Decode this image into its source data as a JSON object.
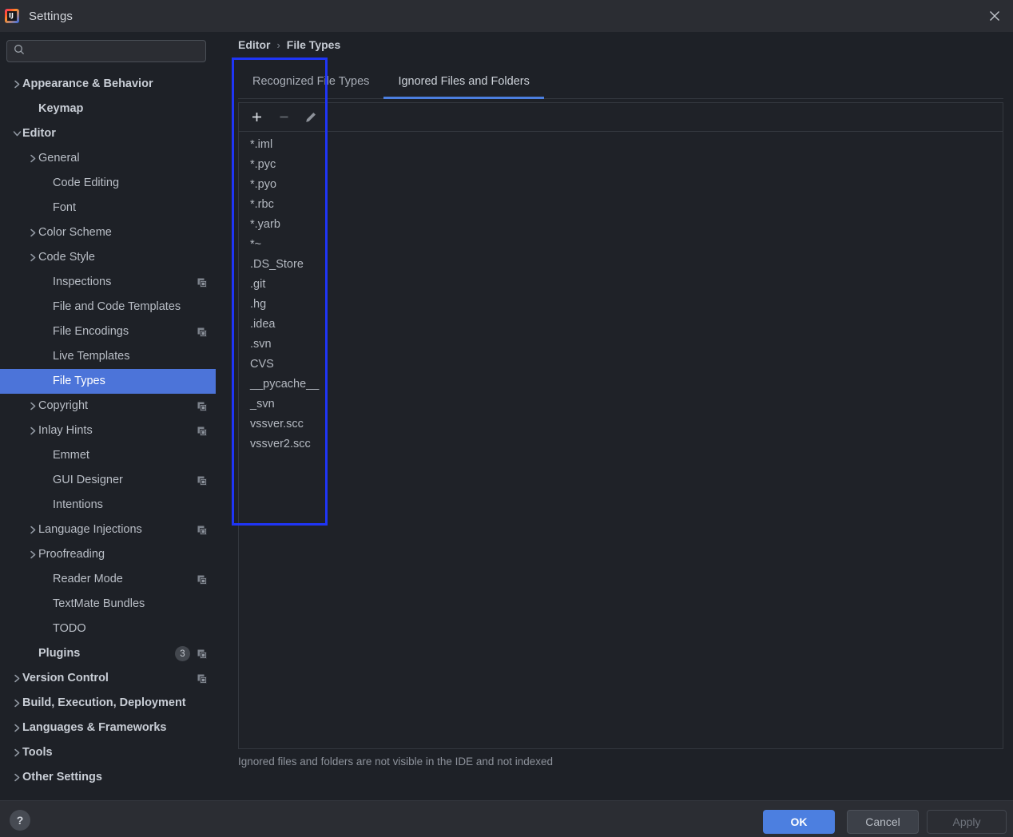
{
  "window": {
    "title": "Settings",
    "logo_icon": "intellij-idea-logo",
    "close_icon": "close-icon"
  },
  "search": {
    "placeholder": "",
    "value": "",
    "icon": "search-icon"
  },
  "sidebar": {
    "items": [
      {
        "label": "Appearance & Behavior",
        "indent": 0,
        "arrow": "chevron-right",
        "bold": true,
        "badge": null,
        "copy": false,
        "selected": false
      },
      {
        "label": "Keymap",
        "indent": 1,
        "arrow": "none",
        "bold": true,
        "badge": null,
        "copy": false,
        "selected": false
      },
      {
        "label": "Editor",
        "indent": 0,
        "arrow": "chevron-down",
        "bold": true,
        "badge": null,
        "copy": false,
        "selected": false
      },
      {
        "label": "General",
        "indent": 1,
        "arrow": "chevron-right",
        "bold": false,
        "badge": null,
        "copy": false,
        "selected": false
      },
      {
        "label": "Code Editing",
        "indent": 2,
        "arrow": "none",
        "bold": false,
        "badge": null,
        "copy": false,
        "selected": false
      },
      {
        "label": "Font",
        "indent": 2,
        "arrow": "none",
        "bold": false,
        "badge": null,
        "copy": false,
        "selected": false
      },
      {
        "label": "Color Scheme",
        "indent": 1,
        "arrow": "chevron-right",
        "bold": false,
        "badge": null,
        "copy": false,
        "selected": false
      },
      {
        "label": "Code Style",
        "indent": 1,
        "arrow": "chevron-right",
        "bold": false,
        "badge": null,
        "copy": false,
        "selected": false
      },
      {
        "label": "Inspections",
        "indent": 2,
        "arrow": "none",
        "bold": false,
        "badge": null,
        "copy": true,
        "selected": false
      },
      {
        "label": "File and Code Templates",
        "indent": 2,
        "arrow": "none",
        "bold": false,
        "badge": null,
        "copy": false,
        "selected": false
      },
      {
        "label": "File Encodings",
        "indent": 2,
        "arrow": "none",
        "bold": false,
        "badge": null,
        "copy": true,
        "selected": false
      },
      {
        "label": "Live Templates",
        "indent": 2,
        "arrow": "none",
        "bold": false,
        "badge": null,
        "copy": false,
        "selected": false
      },
      {
        "label": "File Types",
        "indent": 2,
        "arrow": "none",
        "bold": false,
        "badge": null,
        "copy": false,
        "selected": true
      },
      {
        "label": "Copyright",
        "indent": 1,
        "arrow": "chevron-right",
        "bold": false,
        "badge": null,
        "copy": true,
        "selected": false
      },
      {
        "label": "Inlay Hints",
        "indent": 1,
        "arrow": "chevron-right",
        "bold": false,
        "badge": null,
        "copy": true,
        "selected": false
      },
      {
        "label": "Emmet",
        "indent": 2,
        "arrow": "none",
        "bold": false,
        "badge": null,
        "copy": false,
        "selected": false
      },
      {
        "label": "GUI Designer",
        "indent": 2,
        "arrow": "none",
        "bold": false,
        "badge": null,
        "copy": true,
        "selected": false
      },
      {
        "label": "Intentions",
        "indent": 2,
        "arrow": "none",
        "bold": false,
        "badge": null,
        "copy": false,
        "selected": false
      },
      {
        "label": "Language Injections",
        "indent": 1,
        "arrow": "chevron-right",
        "bold": false,
        "badge": null,
        "copy": true,
        "selected": false
      },
      {
        "label": "Proofreading",
        "indent": 1,
        "arrow": "chevron-right",
        "bold": false,
        "badge": null,
        "copy": false,
        "selected": false
      },
      {
        "label": "Reader Mode",
        "indent": 2,
        "arrow": "none",
        "bold": false,
        "badge": null,
        "copy": true,
        "selected": false
      },
      {
        "label": "TextMate Bundles",
        "indent": 2,
        "arrow": "none",
        "bold": false,
        "badge": null,
        "copy": false,
        "selected": false
      },
      {
        "label": "TODO",
        "indent": 2,
        "arrow": "none",
        "bold": false,
        "badge": null,
        "copy": false,
        "selected": false
      },
      {
        "label": "Plugins",
        "indent": 1,
        "arrow": "none",
        "bold": true,
        "badge": "3",
        "copy": true,
        "selected": false
      },
      {
        "label": "Version Control",
        "indent": 0,
        "arrow": "chevron-right",
        "bold": true,
        "badge": null,
        "copy": true,
        "selected": false
      },
      {
        "label": "Build, Execution, Deployment",
        "indent": 0,
        "arrow": "chevron-right",
        "bold": true,
        "badge": null,
        "copy": false,
        "selected": false
      },
      {
        "label": "Languages & Frameworks",
        "indent": 0,
        "arrow": "chevron-right",
        "bold": true,
        "badge": null,
        "copy": false,
        "selected": false
      },
      {
        "label": "Tools",
        "indent": 0,
        "arrow": "chevron-right",
        "bold": true,
        "badge": null,
        "copy": false,
        "selected": false
      },
      {
        "label": "Other Settings",
        "indent": 0,
        "arrow": "chevron-right",
        "bold": true,
        "badge": null,
        "copy": false,
        "selected": false
      }
    ]
  },
  "main": {
    "breadcrumb": {
      "parent": "Editor",
      "separator": "›",
      "current": "File Types"
    },
    "tabs": [
      {
        "label": "Recognized File Types",
        "active": false
      },
      {
        "label": "Ignored Files and Folders",
        "active": true
      }
    ],
    "toolbar": [
      {
        "name": "add-button",
        "icon": "plus-icon",
        "enabled": true
      },
      {
        "name": "remove-button",
        "icon": "minus-icon",
        "enabled": false
      },
      {
        "name": "edit-button",
        "icon": "pencil-icon",
        "enabled": true
      }
    ],
    "ignored_items": [
      "*.iml",
      "*.pyc",
      "*.pyo",
      "*.rbc",
      "*.yarb",
      "*~",
      ".DS_Store",
      ".git",
      ".hg",
      ".idea",
      ".svn",
      "CVS",
      "__pycache__",
      "_svn",
      "vssver.scc",
      "vssver2.scc"
    ],
    "hint": "Ignored files and folders are not visible in the IDE and not indexed"
  },
  "footer": {
    "help_label": "?",
    "ok_label": "OK",
    "cancel_label": "Cancel",
    "apply_label": "Apply"
  },
  "colors": {
    "accent": "#4c7fe0",
    "selection": "#4c74d9",
    "annotation": "#1f35f5",
    "window_bg": "#1e2127",
    "chrome_bg": "#2b2d33"
  }
}
